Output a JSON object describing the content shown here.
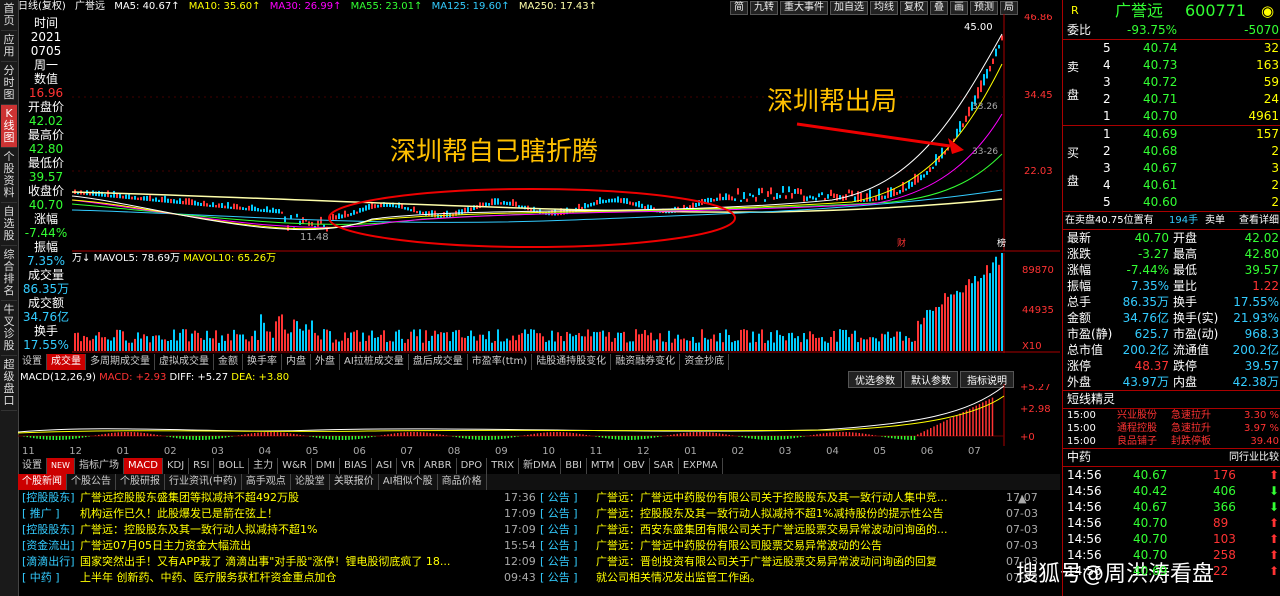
{
  "left_tabs": [
    "首页",
    "应用",
    "分时图",
    "K线图",
    "个股资料",
    "自选股",
    "综合排名",
    "牛叉诊股",
    "超级盘口"
  ],
  "top": {
    "label": "日线(复权)",
    "name": "广誉远",
    "ma5": "MA5: 40.67↑",
    "ma10": "MA10: 35.60↑",
    "ma30": "MA30: 26.99↑",
    "ma55": "MA55: 23.01↑",
    "ma125": "MA125: 19.60↑",
    "ma250": "MA250: 17.43↑",
    "buttons": [
      "简",
      "九转",
      "重大事件",
      "加自选",
      "均线",
      "复权",
      "叠",
      "画",
      "预测",
      "局"
    ]
  },
  "info": {
    "time_label": "时间",
    "year": "2021",
    "date": "0705",
    "weekday": "周一",
    "num_label": "数值",
    "num": "16.96",
    "open_label": "开盘价",
    "open": "42.02",
    "high_label": "最高价",
    "high": "42.80",
    "low_label": "最低价",
    "low": "39.57",
    "close_label": "收盘价",
    "close": "40.70",
    "chg_label": "涨幅",
    "chg": "-7.44%",
    "amp_label": "振幅",
    "amp": "7.35%",
    "vol_label": "成交量",
    "vol": "86.35万",
    "amt_label": "成交额",
    "amt": "34.76亿",
    "turn_label": "换手",
    "turn": "17.55%"
  },
  "kline": {
    "annot1": "深圳帮自己瞎折腾",
    "annot2": "深圳帮出局",
    "price_top": "46.86",
    "price_mid": "34.45",
    "price_low": "22.03",
    "peak": "45.00",
    "trough": "11.48",
    "right1": "33.26",
    "right2": "33-26",
    "marker_cai": "财",
    "marker_bang": "榜"
  },
  "vol": {
    "label": "万↓",
    "mavol5": "MAVOL5: 78.69万",
    "mavol10": "MAVOL10: 65.26万",
    "top": "89870",
    "mid": "44935",
    "unit": "X10"
  },
  "tabs1": [
    "设置",
    "成交量",
    "多周期成交量",
    "虚拟成交量",
    "金额",
    "换手率",
    "内盘",
    "外盘",
    "AI拉桩成交量",
    "盘后成交量",
    "市盈率(ttm)",
    "陆股通持股变化",
    "融资融券变化",
    "资金抄底"
  ],
  "macd": {
    "label": "MACD(12,26,9)",
    "macd": "MACD: +2.93",
    "diff": "DIFF: +5.27",
    "dea": "DEA: +3.80",
    "btns": [
      "优选参数",
      "默认参数",
      "指标说明"
    ],
    "y1": "+5.27",
    "y2": "+2.98",
    "y3": "+0"
  },
  "dates": [
    "11",
    "12",
    "01",
    "02",
    "03",
    "04",
    "05",
    "06",
    "07",
    "08",
    "09",
    "10",
    "11",
    "12",
    "01",
    "02",
    "03",
    "04",
    "05",
    "06",
    "07"
  ],
  "tabs2": [
    "设置",
    "指标广场",
    "MACD",
    "KDJ",
    "RSI",
    "BOLL",
    "主力",
    "W&R",
    "DMI",
    "BIAS",
    "ASI",
    "VR",
    "ARBR",
    "DPO",
    "TRIX",
    "新DMA",
    "BBI",
    "MTM",
    "OBV",
    "SAR",
    "EXPMA"
  ],
  "newtag": "NEW",
  "news_tabs": [
    "个股新闻",
    "个股公告",
    "个股研报",
    "行业资讯(中药)",
    "高手观点",
    "论股堂",
    "关联报价",
    "AI相似个股",
    "商品价格"
  ],
  "news_left": [
    {
      "tag": "[控股股东]",
      "title": "广誉远控股股东盛集团等拟减持不超492万股",
      "time": "17:36"
    },
    {
      "tag": "[ 推广 ]",
      "title": "机构运作已久！此股爆发已是箭在弦上！",
      "time": "17:09"
    },
    {
      "tag": "[控股股东]",
      "title": "广誉远：控股股东及其一致行动人拟减持不超1%",
      "time": "17:09"
    },
    {
      "tag": "[资金流出]",
      "title": "广誉远07月05日主力资金大幅流出",
      "time": "15:54"
    },
    {
      "tag": "[滴滴出行]",
      "title": "国家突然出手！又有APP栽了 滴滴出事\"对手股\"涨停！锂电股彻底疯了 18...",
      "time": "12:09"
    },
    {
      "tag": "[ 中药 ]",
      "title": "上半年 创新药、中药、医疗服务获杠杆资金重点加仓",
      "time": "09:43"
    }
  ],
  "news_right": [
    {
      "tag": "[ 公告 ]",
      "title": "广誉远：广誉远中药股份有限公司关于控股股东及其一致行动人集中竞...",
      "date": "17:07"
    },
    {
      "tag": "[ 公告 ]",
      "title": "广誉远：控股股东及其一致行动人拟减持不超1%减持股份的提示性公告",
      "date": "07-03"
    },
    {
      "tag": "[ 公告 ]",
      "title": "广誉远：西安东盛集团有限公司关于广誉远股票交易异常波动问询函的...",
      "date": "07-03"
    },
    {
      "tag": "[ 公告 ]",
      "title": "广誉远：广誉远中药股份有限公司股票交易异常波动的公告",
      "date": "07-03"
    },
    {
      "tag": "[ 公告 ]",
      "title": "广誉远：晋创投资有限公司关于广誉远股票交易异常波动问询函的回复",
      "date": "07-03"
    },
    {
      "tag": "[ 公告 ]",
      "title": "就公司相关情况发出监管工作函。",
      "date": "07-03"
    }
  ],
  "watermark": "搜狐号@周洪涛看盘",
  "right": {
    "r": "R",
    "name": "广誉远",
    "code": "600771",
    "weibi_label": "委比",
    "weibi": "-93.75%",
    "weicha": "-5070",
    "sell_label1": "卖",
    "sell_label2": "盘",
    "buy_label1": "买",
    "buy_label2": "盘",
    "sells": [
      {
        "n": "5",
        "p": "40.74",
        "v": "32"
      },
      {
        "n": "4",
        "p": "40.73",
        "v": "163"
      },
      {
        "n": "3",
        "p": "40.72",
        "v": "59"
      },
      {
        "n": "2",
        "p": "40.71",
        "v": "24"
      },
      {
        "n": "1",
        "p": "40.70",
        "v": "4961"
      }
    ],
    "buys": [
      {
        "n": "1",
        "p": "40.69",
        "v": "157"
      },
      {
        "n": "2",
        "p": "40.68",
        "v": "2"
      },
      {
        "n": "3",
        "p": "40.67",
        "v": "3"
      },
      {
        "n": "4",
        "p": "40.61",
        "v": "2"
      },
      {
        "n": "5",
        "p": "40.60",
        "v": "2"
      }
    ],
    "maimai": "在卖盘40.75位置有",
    "maimai_v": "194手",
    "maimai_btn": "卖单",
    "view": "查看详细",
    "stats": [
      {
        "l1": "最新",
        "v1": "40.70",
        "l2": "开盘",
        "v2": "42.02"
      },
      {
        "l1": "涨跌",
        "v1": "-3.27",
        "l2": "最高",
        "v2": "42.80"
      },
      {
        "l1": "涨幅",
        "v1": "-7.44%",
        "l2": "最低",
        "v2": "39.57"
      },
      {
        "l1": "振幅",
        "v1": "7.35%",
        "l2": "量比",
        "v2": "1.22"
      },
      {
        "l1": "总手",
        "v1": "86.35万",
        "l2": "换手",
        "v2": "17.55%"
      },
      {
        "l1": "金额",
        "v1": "34.76亿",
        "l2": "换手(实)",
        "v2": "21.93%"
      },
      {
        "l1": "市盈(静)",
        "v1": "625.7",
        "l2": "市盈(动)",
        "v2": "968.3"
      },
      {
        "l1": "总市值",
        "v1": "200.2亿",
        "l2": "流通值",
        "v2": "200.2亿"
      },
      {
        "l1": "涨停",
        "v1": "48.37",
        "l2": "跌停",
        "v2": "39.57"
      },
      {
        "l1": "外盘",
        "v1": "43.97万",
        "l2": "内盘",
        "v2": "42.38万"
      }
    ],
    "short_title": "短线精灵",
    "short": [
      {
        "t": "15:00",
        "n": "兴业股份",
        "e": "急速拉升",
        "v": "3.30 %"
      },
      {
        "t": "15:00",
        "n": "通程控股",
        "e": "急速拉升",
        "v": "3.97 %"
      },
      {
        "t": "15:00",
        "n": "良品铺子",
        "e": "封跌停板",
        "v": "39.40"
      }
    ],
    "ticks_title": "中药",
    "ticks_btn": "同行业比较",
    "ticks": [
      {
        "t": "14:56",
        "p": "40.67",
        "v": "176"
      },
      {
        "t": "14:56",
        "p": "40.42",
        "v": "406"
      },
      {
        "t": "14:56",
        "p": "40.67",
        "v": "366"
      },
      {
        "t": "14:56",
        "p": "40.70",
        "v": "89"
      },
      {
        "t": "14:56",
        "p": "40.70",
        "v": "103"
      },
      {
        "t": "14:56",
        "p": "40.70",
        "v": "258"
      },
      {
        "t": "14:56",
        "p": "40.69",
        "v": "22"
      }
    ]
  }
}
